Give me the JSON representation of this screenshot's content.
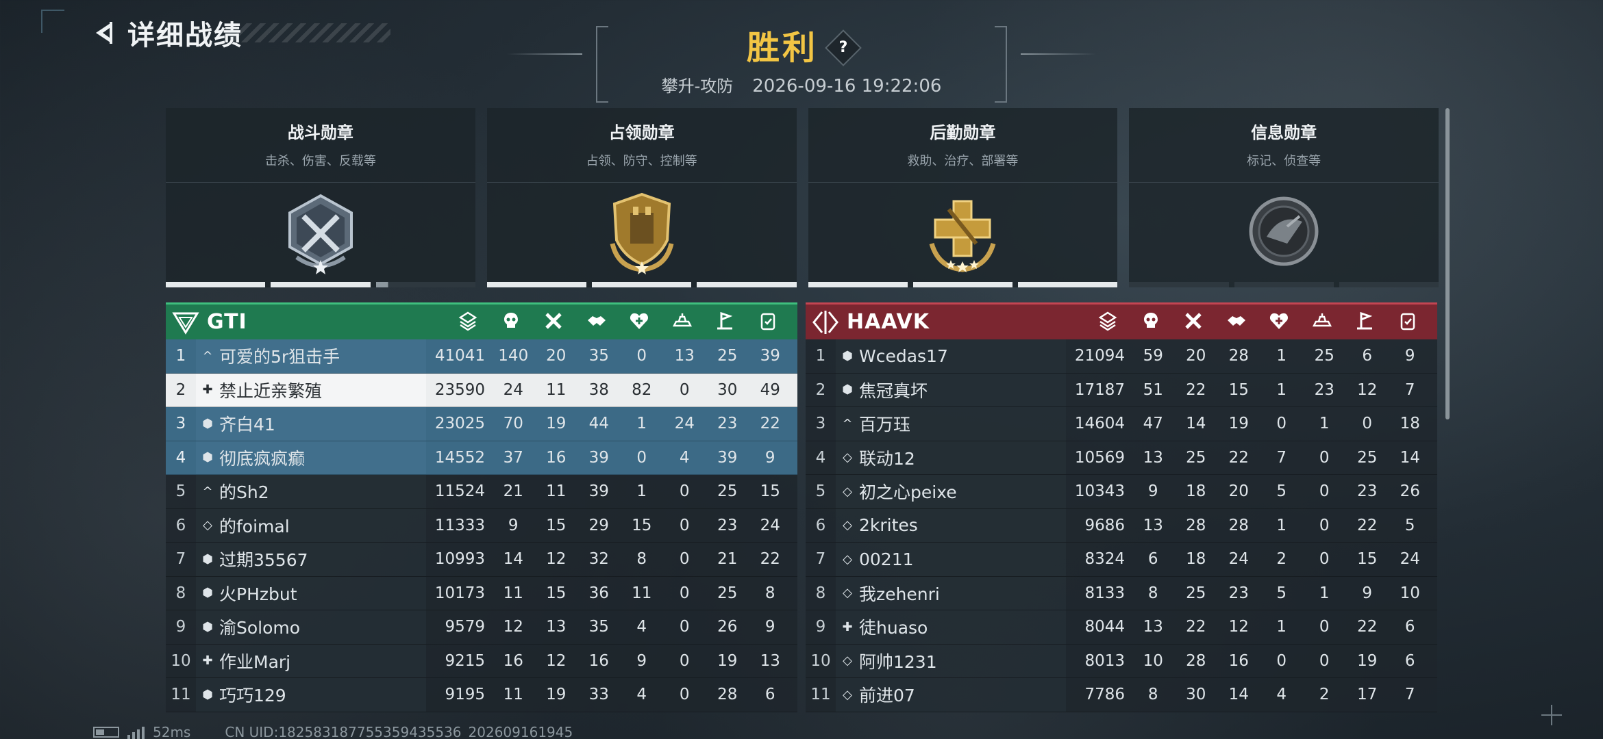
{
  "header": {
    "back_label": "详细战绩",
    "result": "胜利",
    "help": "?",
    "mode": "攀升-攻防",
    "datetime": "2026-09-16 19:22:06"
  },
  "medals": [
    {
      "title": "战斗勋章",
      "desc": "击杀、伤害、反载等",
      "icon": "combat-medal-icon",
      "progress": [
        1,
        1,
        0.15
      ]
    },
    {
      "title": "占领勋章",
      "desc": "占领、防守、控制等",
      "icon": "capture-medal-icon",
      "progress": [
        1,
        1,
        1
      ]
    },
    {
      "title": "后勤勋章",
      "desc": "救助、治疗、部署等",
      "icon": "logistics-medal-icon",
      "progress": [
        1,
        1,
        1
      ]
    },
    {
      "title": "信息勋章",
      "desc": "标记、侦查等",
      "icon": "intel-medal-icon",
      "progress": [
        0,
        0,
        0
      ]
    }
  ],
  "stat_icons": [
    "score-icon",
    "kills-icon",
    "deaths-icon",
    "assists-icon",
    "revives-icon",
    "vehicle-icon",
    "capture-icon",
    "objective-icon"
  ],
  "teams": {
    "left": {
      "name": "GTI",
      "color": "#1f7a50",
      "rows": [
        {
          "rank": "1",
          "role": "^",
          "name": "可爱的5r狙击手",
          "score": "41041",
          "stats": [
            "140",
            "20",
            "35",
            "0",
            "13",
            "25",
            "39"
          ],
          "state": "squad"
        },
        {
          "rank": "2",
          "role": "✚",
          "name": "禁止近亲繁殖",
          "score": "23590",
          "stats": [
            "24",
            "11",
            "38",
            "82",
            "0",
            "30",
            "49"
          ],
          "state": "self"
        },
        {
          "rank": "3",
          "role": "⬢",
          "name": "齐白41",
          "score": "23025",
          "stats": [
            "70",
            "19",
            "44",
            "1",
            "24",
            "23",
            "22"
          ],
          "state": "squad"
        },
        {
          "rank": "4",
          "role": "⬢",
          "name": "彻底疯疯癫",
          "score": "14552",
          "stats": [
            "37",
            "16",
            "39",
            "0",
            "4",
            "39",
            "9"
          ],
          "state": "squad"
        },
        {
          "rank": "5",
          "role": "^",
          "name": "的Sh2",
          "score": "11524",
          "stats": [
            "21",
            "11",
            "39",
            "1",
            "0",
            "25",
            "15"
          ],
          "state": ""
        },
        {
          "rank": "6",
          "role": "◇",
          "name": "的foimal",
          "score": "11333",
          "stats": [
            "9",
            "15",
            "29",
            "15",
            "0",
            "23",
            "24"
          ],
          "state": ""
        },
        {
          "rank": "7",
          "role": "⬢",
          "name": "过期35567",
          "score": "10993",
          "stats": [
            "14",
            "12",
            "32",
            "8",
            "0",
            "21",
            "22"
          ],
          "state": ""
        },
        {
          "rank": "8",
          "role": "⬢",
          "name": "火PHzbut",
          "score": "10173",
          "stats": [
            "11",
            "15",
            "36",
            "11",
            "0",
            "25",
            "8"
          ],
          "state": ""
        },
        {
          "rank": "9",
          "role": "⬢",
          "name": "渝Solomo",
          "score": "9579",
          "stats": [
            "12",
            "13",
            "35",
            "4",
            "0",
            "26",
            "9"
          ],
          "state": ""
        },
        {
          "rank": "10",
          "role": "✚",
          "name": "作业Marj",
          "score": "9215",
          "stats": [
            "16",
            "12",
            "16",
            "9",
            "0",
            "19",
            "13"
          ],
          "state": ""
        },
        {
          "rank": "11",
          "role": "⬢",
          "name": "巧巧129",
          "score": "9195",
          "stats": [
            "11",
            "19",
            "33",
            "4",
            "0",
            "28",
            "6"
          ],
          "state": ""
        }
      ]
    },
    "right": {
      "name": "HAAVK",
      "color": "#7b2630",
      "rows": [
        {
          "rank": "1",
          "role": "⬢",
          "name": "Wcedas17",
          "score": "21094",
          "stats": [
            "59",
            "20",
            "28",
            "1",
            "25",
            "6",
            "9"
          ],
          "state": ""
        },
        {
          "rank": "2",
          "role": "⬢",
          "name": "焦冠真坏",
          "score": "17187",
          "stats": [
            "51",
            "22",
            "15",
            "1",
            "23",
            "12",
            "7"
          ],
          "state": ""
        },
        {
          "rank": "3",
          "role": "^",
          "name": "百万珏",
          "score": "14604",
          "stats": [
            "47",
            "14",
            "19",
            "0",
            "1",
            "0",
            "18"
          ],
          "state": ""
        },
        {
          "rank": "4",
          "role": "◇",
          "name": "联动12",
          "score": "10569",
          "stats": [
            "13",
            "25",
            "22",
            "7",
            "0",
            "25",
            "14"
          ],
          "state": ""
        },
        {
          "rank": "5",
          "role": "◇",
          "name": "初之心peixe",
          "score": "10343",
          "stats": [
            "9",
            "18",
            "20",
            "5",
            "0",
            "23",
            "26"
          ],
          "state": ""
        },
        {
          "rank": "6",
          "role": "◇",
          "name": "2krites",
          "score": "9686",
          "stats": [
            "13",
            "28",
            "28",
            "1",
            "0",
            "22",
            "5"
          ],
          "state": ""
        },
        {
          "rank": "7",
          "role": "◇",
          "name": "00211",
          "score": "8324",
          "stats": [
            "6",
            "18",
            "24",
            "2",
            "0",
            "15",
            "24"
          ],
          "state": ""
        },
        {
          "rank": "8",
          "role": "◇",
          "name": "我zehenri",
          "score": "8133",
          "stats": [
            "8",
            "25",
            "23",
            "5",
            "1",
            "9",
            "10"
          ],
          "state": ""
        },
        {
          "rank": "9",
          "role": "✚",
          "name": "徒huaso",
          "score": "8044",
          "stats": [
            "13",
            "22",
            "12",
            "1",
            "0",
            "22",
            "6"
          ],
          "state": ""
        },
        {
          "rank": "10",
          "role": "◇",
          "name": "阿帅1231",
          "score": "8013",
          "stats": [
            "10",
            "28",
            "16",
            "0",
            "0",
            "19",
            "6"
          ],
          "state": ""
        },
        {
          "rank": "11",
          "role": "◇",
          "name": "前进07",
          "score": "7786",
          "stats": [
            "8",
            "30",
            "14",
            "4",
            "2",
            "17",
            "7"
          ],
          "state": ""
        }
      ]
    }
  },
  "footer": {
    "ping": "52ms",
    "uid": "CN UID:182583187755359435536_202609161945"
  }
}
